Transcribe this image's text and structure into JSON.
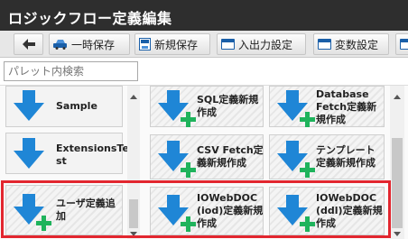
{
  "title": "ロジックフロー定義編集",
  "toolbar": {
    "back_icon": "arrow-left-icon",
    "temp_save": "一時保存",
    "new_save": "新規保存",
    "io_settings": "入出力設定",
    "var_settings": "変数設定"
  },
  "search": {
    "placeholder": "パレット内検索"
  },
  "palette": {
    "left_items": [
      {
        "label": "Sample",
        "icon": "down-arrow-icon"
      },
      {
        "label_lines": [
          "ExtensionsTe",
          "st"
        ],
        "icon": "down-arrow-icon"
      },
      {
        "label_lines": [
          "ユーザ定義追",
          "加"
        ],
        "icon": "down-arrow-add-icon"
      }
    ],
    "right_items": [
      {
        "label_lines": [
          "SQL定義新規",
          "作成"
        ],
        "icon": "down-arrow-add-icon"
      },
      {
        "label_lines": [
          "Database",
          "Fetch定義新",
          "規作成"
        ],
        "icon": "down-arrow-add-icon"
      },
      {
        "label_lines": [
          "CSV Fetch定",
          "義新規作成"
        ],
        "icon": "down-arrow-add-icon"
      },
      {
        "label_lines": [
          "テンプレート",
          "定義新規作成"
        ],
        "icon": "down-arrow-add-icon"
      },
      {
        "label_lines": [
          "IOWebDOC",
          "(iod)定義新規",
          "作成"
        ],
        "icon": "down-arrow-add-icon"
      },
      {
        "label_lines": [
          "IOWebDOC",
          "(ddl)定義新規",
          "作成"
        ],
        "icon": "down-arrow-add-icon"
      }
    ]
  },
  "colors": {
    "accent_blue": "#1f86d6",
    "plus_green": "#1fb35c",
    "highlight_red": "#e2262f",
    "title_bg": "#2e2e2e"
  }
}
